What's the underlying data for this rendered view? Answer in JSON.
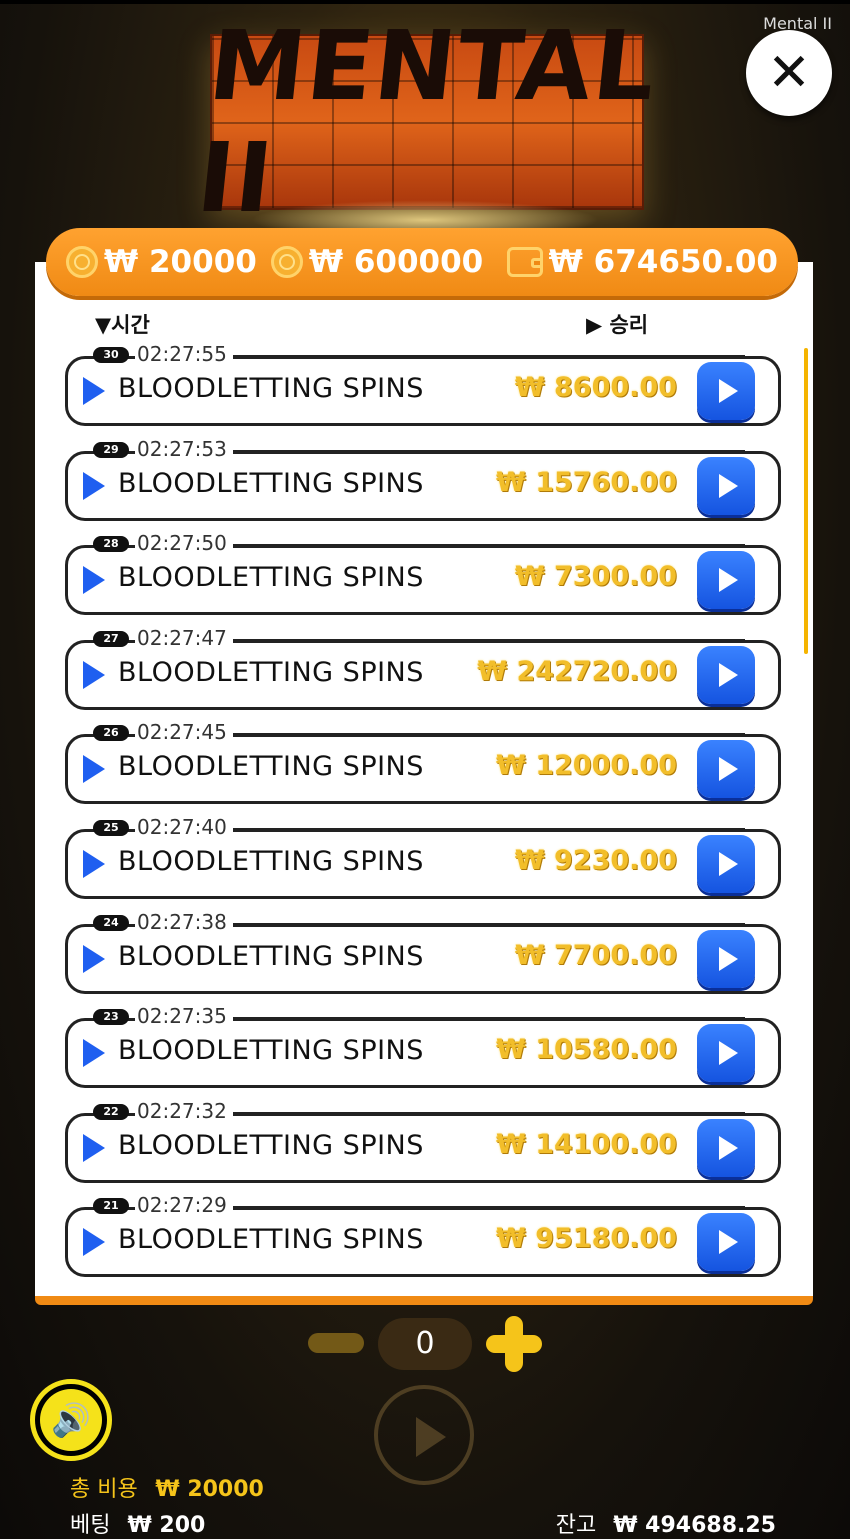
{
  "window": {
    "title": "Mental II"
  },
  "logo": {
    "text": "MENTAL II"
  },
  "header": {
    "bet_1": "₩ 20000",
    "bet_2": "₩ 600000",
    "total": "₩ 674650.00"
  },
  "columns": {
    "time": "▼시간",
    "win": "▶ 승리"
  },
  "rows": [
    {
      "id": "30",
      "time": "02:27:55",
      "name": "BLOODLETTING SPINS",
      "amount": "₩ 8600.00"
    },
    {
      "id": "29",
      "time": "02:27:53",
      "name": "BLOODLETTING SPINS",
      "amount": "₩ 15760.00"
    },
    {
      "id": "28",
      "time": "02:27:50",
      "name": "BLOODLETTING SPINS",
      "amount": "₩ 7300.00"
    },
    {
      "id": "27",
      "time": "02:27:47",
      "name": "BLOODLETTING SPINS",
      "amount": "₩ 242720.00"
    },
    {
      "id": "26",
      "time": "02:27:45",
      "name": "BLOODLETTING SPINS",
      "amount": "₩ 12000.00"
    },
    {
      "id": "25",
      "time": "02:27:40",
      "name": "BLOODLETTING SPINS",
      "amount": "₩ 9230.00"
    },
    {
      "id": "24",
      "time": "02:27:38",
      "name": "BLOODLETTING SPINS",
      "amount": "₩ 7700.00"
    },
    {
      "id": "23",
      "time": "02:27:35",
      "name": "BLOODLETTING SPINS",
      "amount": "₩ 10580.00"
    },
    {
      "id": "22",
      "time": "02:27:32",
      "name": "BLOODLETTING SPINS",
      "amount": "₩ 14100.00"
    },
    {
      "id": "21",
      "time": "02:27:29",
      "name": "BLOODLETTING SPINS",
      "amount": "₩ 95180.00"
    }
  ],
  "controls": {
    "counter": "0"
  },
  "footer": {
    "total_label": "총 비용",
    "total_value": "₩ 20000",
    "bet_label": "베팅",
    "bet_value": "₩ 200",
    "balance_label": "잔고",
    "balance_value": "₩ 494688.25"
  },
  "colors": {
    "accent": "#f08a14",
    "play": "#1f5ff0",
    "win_amount": "#f2be2a",
    "sound_ring": "#f5e21a"
  }
}
